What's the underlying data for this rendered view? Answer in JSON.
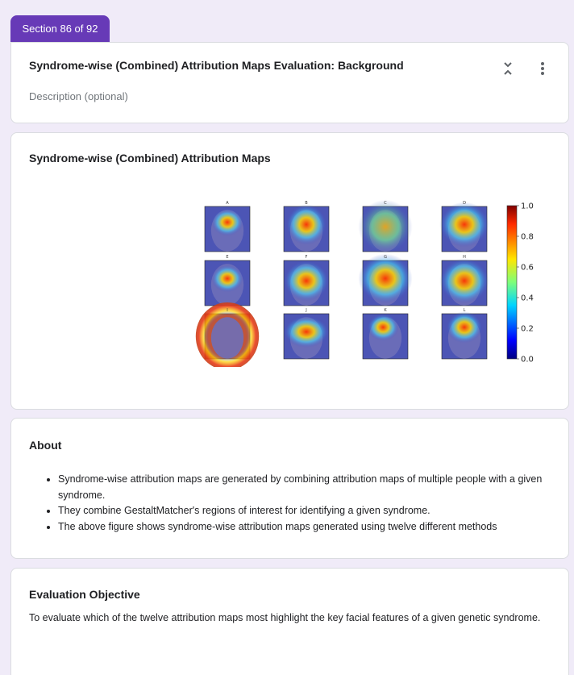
{
  "section_tab": "Section 86 of 92",
  "header": {
    "title": "Syndrome-wise (Combined) Attribution Maps Evaluation: Background",
    "description_placeholder": "Description (optional)",
    "collapse_icon": "collapse-expand-icon",
    "more_icon": "more-vert-icon"
  },
  "figure_card": {
    "title": "Syndrome-wise (Combined) Attribution Maps",
    "panel_labels": [
      "A",
      "B",
      "C",
      "D",
      "E",
      "F",
      "G",
      "H",
      "I",
      "J",
      "K",
      "L"
    ],
    "colorbar_ticks": [
      "1.0",
      "0.8",
      "0.6",
      "0.4",
      "0.2",
      "0.0"
    ]
  },
  "about": {
    "title": "About",
    "items": [
      "Syndrome-wise attribution maps are generated by combining attribution maps of multiple people with a given syndrome.",
      "They combine GestaltMatcher's regions of interest for identifying a given syndrome.",
      "The above figure shows syndrome-wise attribution maps generated using twelve different methods"
    ]
  },
  "objective": {
    "title": "Evaluation Objective",
    "text": "To evaluate which of the twelve attribution maps most highlight the key facial features of a given genetic syndrome."
  },
  "colors": {
    "accent": "#673ab7",
    "background": "#f0ebf8"
  }
}
